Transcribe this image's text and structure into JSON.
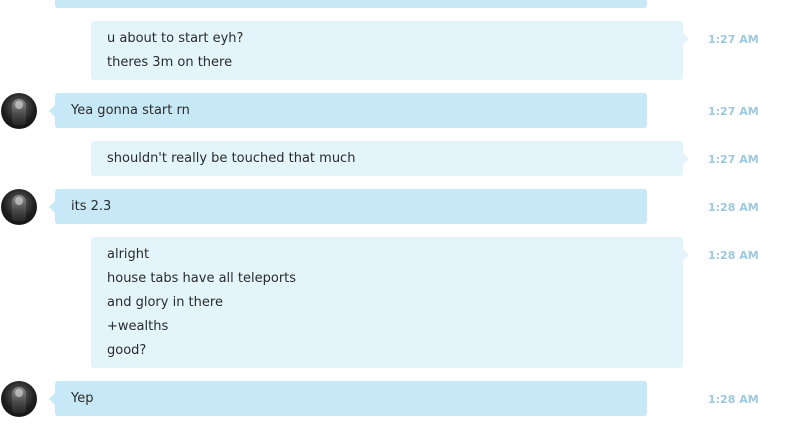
{
  "messages": [
    {
      "side": "in",
      "lines": [],
      "time": ""
    },
    {
      "side": "out",
      "lines": [
        "u about to start eyh?",
        "theres 3m on there"
      ],
      "time": "1:27 AM"
    },
    {
      "side": "in",
      "lines": [
        "Yea gonna start rn"
      ],
      "time": "1:27 AM"
    },
    {
      "side": "out",
      "lines": [
        "shouldn't really be touched that much"
      ],
      "time": "1:27 AM"
    },
    {
      "side": "in",
      "lines": [
        "its 2.3"
      ],
      "time": "1:28 AM"
    },
    {
      "side": "out",
      "lines": [
        "alright",
        "house tabs have all teleports",
        "and glory in there",
        "+wealths",
        "good?"
      ],
      "time": "1:28 AM"
    },
    {
      "side": "in",
      "lines": [
        "Yep"
      ],
      "time": "1:28 AM"
    }
  ],
  "colors": {
    "incoming_bubble": "#c7e9f7",
    "outgoing_bubble": "#e3f4fb",
    "timestamp": "#9cc9df"
  },
  "icons": {
    "avatar": "user-avatar-icon"
  }
}
